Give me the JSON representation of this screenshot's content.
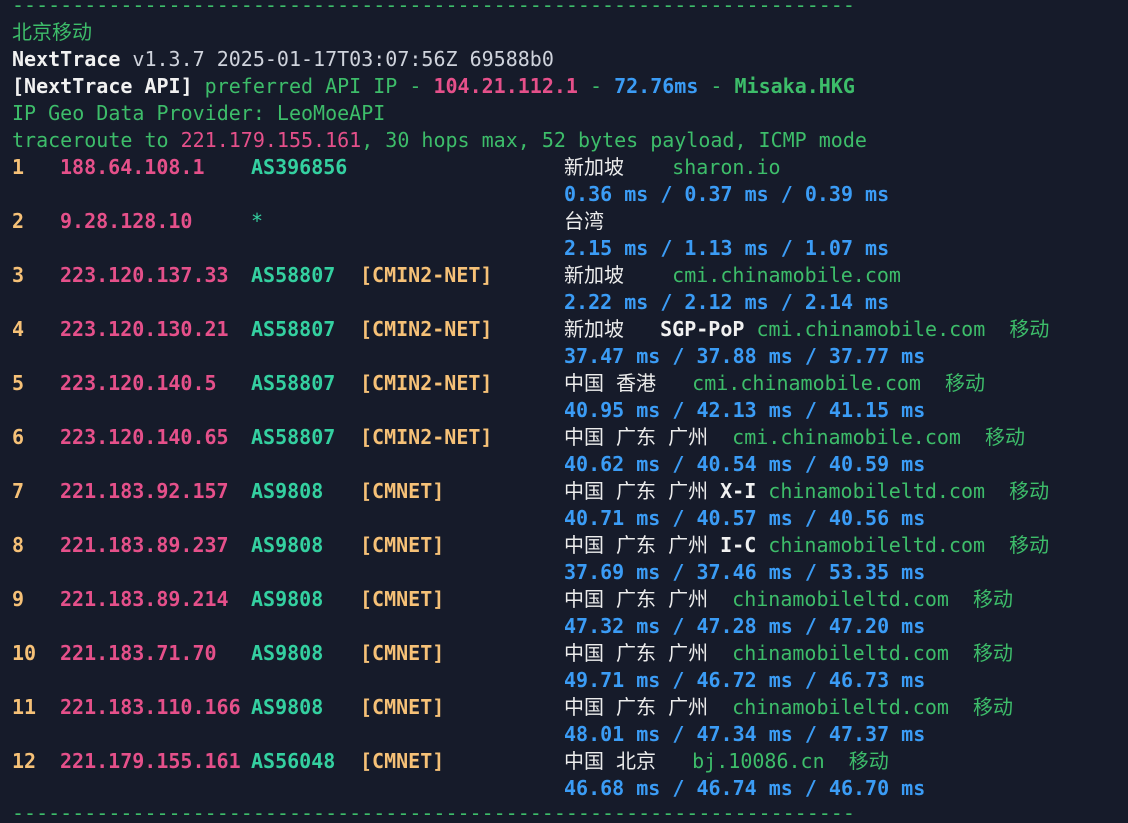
{
  "dash_line": "----------------------------------------------------------------------",
  "header": {
    "location": "北京移动",
    "version_name": "NextTrace",
    "version_info": "v1.3.7 2025-01-17T03:07:56Z 69588b0",
    "api_tag": "[NextTrace API]",
    "api_text": " preferred API IP - ",
    "api_ip": "104.21.112.1",
    "api_sep1": " - ",
    "api_latency": "72.76ms",
    "api_sep2": " - ",
    "api_node": "Misaka.HKG",
    "geo_provider": "IP Geo Data Provider: LeoMoeAPI",
    "trace_prefix": "traceroute to ",
    "trace_target": "221.179.155.161",
    "trace_suffix": ", 30 hops max, 52 bytes payload, ICMP mode"
  },
  "hops": [
    {
      "num": "1",
      "ip": "188.64.108.1",
      "as": "AS396856",
      "tag": "",
      "geo": "新加坡    ",
      "geo_extra": "",
      "host": "sharon.io",
      "isp": "",
      "times": [
        "0.36 ms",
        "0.37 ms",
        "0.39 ms"
      ]
    },
    {
      "num": "2",
      "ip": "9.28.128.10",
      "as": "*",
      "tag": "",
      "geo": "台湾",
      "geo_extra": "",
      "host": "",
      "isp": "",
      "times": [
        "2.15 ms",
        "1.13 ms",
        "1.07 ms"
      ]
    },
    {
      "num": "3",
      "ip": "223.120.137.33",
      "as": "AS58807",
      "tag": "[CMIN2-NET]",
      "geo": "新加坡    ",
      "geo_extra": "",
      "host": "cmi.chinamobile.com",
      "isp": "",
      "times": [
        "2.22 ms",
        "2.12 ms",
        "2.14 ms"
      ]
    },
    {
      "num": "4",
      "ip": "223.120.130.21",
      "as": "AS58807",
      "tag": "[CMIN2-NET]",
      "geo": "新加坡   ",
      "geo_extra": "SGP-PoP ",
      "host": "cmi.chinamobile.com",
      "isp": "  移动",
      "times": [
        "37.47 ms",
        "37.88 ms",
        "37.77 ms"
      ]
    },
    {
      "num": "5",
      "ip": "223.120.140.5",
      "as": "AS58807",
      "tag": "[CMIN2-NET]",
      "geo": "中国 香港   ",
      "geo_extra": "",
      "host": "cmi.chinamobile.com",
      "isp": "  移动",
      "times": [
        "40.95 ms",
        "42.13 ms",
        "41.15 ms"
      ]
    },
    {
      "num": "6",
      "ip": "223.120.140.65",
      "as": "AS58807",
      "tag": "[CMIN2-NET]",
      "geo": "中国 广东 广州  ",
      "geo_extra": "",
      "host": "cmi.chinamobile.com",
      "isp": "  移动",
      "times": [
        "40.62 ms",
        "40.54 ms",
        "40.59 ms"
      ]
    },
    {
      "num": "7",
      "ip": "221.183.92.157",
      "as": "AS9808",
      "tag": "[CMNET]",
      "geo": "中国 广东 广州 ",
      "geo_extra": "X-I ",
      "host": "chinamobileltd.com",
      "isp": "  移动",
      "times": [
        "40.71 ms",
        "40.57 ms",
        "40.56 ms"
      ]
    },
    {
      "num": "8",
      "ip": "221.183.89.237",
      "as": "AS9808",
      "tag": "[CMNET]",
      "geo": "中国 广东 广州 ",
      "geo_extra": "I-C ",
      "host": "chinamobileltd.com",
      "isp": "  移动",
      "times": [
        "37.69 ms",
        "37.46 ms",
        "53.35 ms"
      ]
    },
    {
      "num": "9",
      "ip": "221.183.89.214",
      "as": "AS9808",
      "tag": "[CMNET]",
      "geo": "中国 广东 广州  ",
      "geo_extra": "",
      "host": "chinamobileltd.com",
      "isp": "  移动",
      "times": [
        "47.32 ms",
        "47.28 ms",
        "47.20 ms"
      ]
    },
    {
      "num": "10",
      "ip": "221.183.71.70",
      "as": "AS9808",
      "tag": "[CMNET]",
      "geo": "中国 广东 广州  ",
      "geo_extra": "",
      "host": "chinamobileltd.com",
      "isp": "  移动",
      "times": [
        "49.71 ms",
        "46.72 ms",
        "46.73 ms"
      ]
    },
    {
      "num": "11",
      "ip": "221.183.110.166",
      "as": "AS9808",
      "tag": "[CMNET]",
      "geo": "中国 广东 广州  ",
      "geo_extra": "",
      "host": "chinamobileltd.com",
      "isp": "  移动",
      "times": [
        "48.01 ms",
        "47.34 ms",
        "47.37 ms"
      ]
    },
    {
      "num": "12",
      "ip": "221.179.155.161",
      "as": "AS56048",
      "tag": "[CMNET]",
      "geo": "中国 北京   ",
      "geo_extra": "",
      "host": "bj.10086.cn",
      "isp": "  移动",
      "times": [
        "46.68 ms",
        "46.74 ms",
        "46.70 ms"
      ]
    }
  ],
  "time_sep": " / ",
  "colors": {
    "background": "#161b2a",
    "green": "#3dbd6a",
    "pink": "#e5508a",
    "blue": "#3b9cf5",
    "yellow": "#f6c177",
    "teal": "#34d0a0"
  }
}
